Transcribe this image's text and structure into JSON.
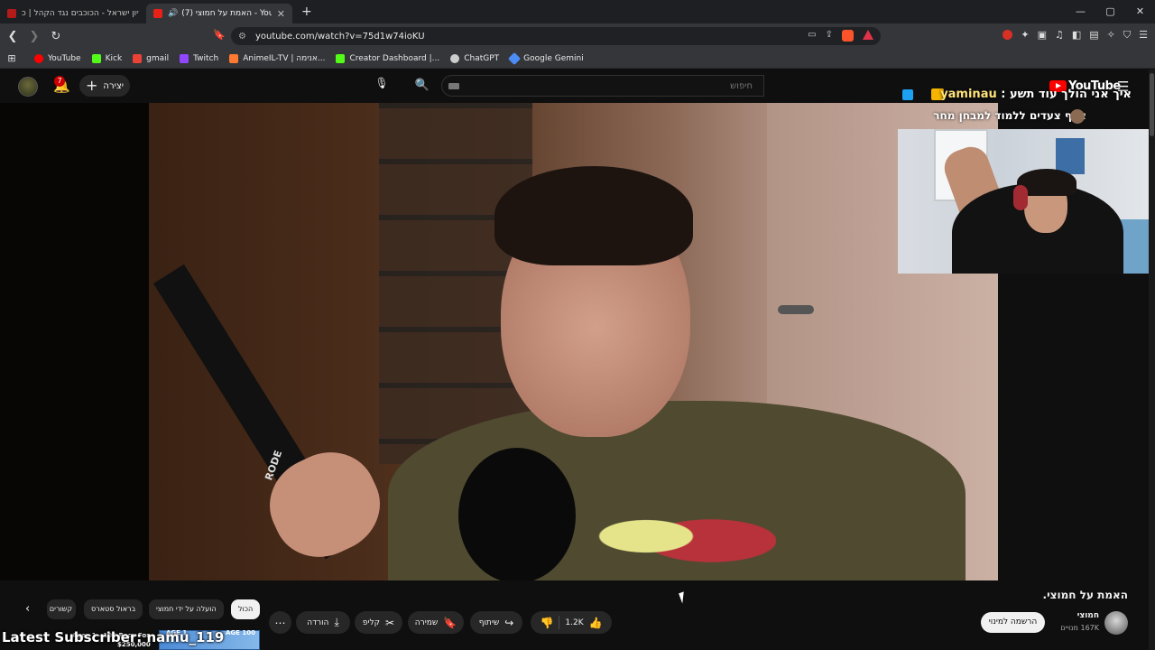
{
  "browser": {
    "tabs": [
      {
        "title": "אירוויזיון ישראל - הכוכבים נגד הקהל | כ...",
        "active": false
      },
      {
        "title": "(7) האמת על חמוצי - YouTube",
        "active": true
      }
    ],
    "new_tab_glyph": "+",
    "window_controls": [
      "—",
      "▢",
      "✕"
    ],
    "url": "youtube.com/watch?v=75d1w74ioKU",
    "bookmarks": [
      {
        "label": "YouTube",
        "icon": "youtube-icon",
        "color": "#ff0000"
      },
      {
        "label": "Kick",
        "icon": "kick-icon",
        "color": "#53fc18"
      },
      {
        "label": "gmail",
        "icon": "gmail-icon",
        "color": "#ea4335"
      },
      {
        "label": "Twitch",
        "icon": "twitch-icon",
        "color": "#9146ff"
      },
      {
        "label": "AnimeIL-TV | אנימה...",
        "icon": "anime-icon",
        "color": "#ff7a30"
      },
      {
        "label": "Creator Dashboard |...",
        "icon": "kick-icon",
        "color": "#53fc18"
      },
      {
        "label": "ChatGPT",
        "icon": "chatgpt-icon",
        "color": "#cccccc"
      },
      {
        "label": "Google Gemini",
        "icon": "gemini-icon",
        "color": "#4e8cf5"
      }
    ]
  },
  "youtube": {
    "notifications_count": "7",
    "create_label": "יצירה",
    "search_placeholder": "חיפוש",
    "logo_text": "YouTube",
    "video": {
      "title": "האמת על חמוצי.",
      "channel_name": "חמוצי",
      "channel_subs": "167K מנויים",
      "subscribe_label": "הרשמה למינוי",
      "likes": "1.2K",
      "share_label": "שיתוף",
      "save_label": "שמירה",
      "clip_label": "קליפ",
      "download_label": "הורדה"
    },
    "chips": [
      {
        "label": "הכול",
        "active": true
      },
      {
        "label": "הועלה על ידי חמוצי",
        "active": false
      },
      {
        "label": "בראול סטארס",
        "active": false
      },
      {
        "label": "קשורים",
        "active": false
      }
    ]
  },
  "stream_overlay": {
    "line1_user": "yaminau",
    "line1_text": "איך אני הולך עוד תשע :",
    "line2_text": "אלף צעדים ללמוד למבחן מחר",
    "footer_text": "Latest Subscriber: namu_119",
    "game_title": "Ages 1 - 100 Race For",
    "game_prize": "$250,000",
    "game_age1": "AGE 1",
    "game_age2": "AGE 100",
    "mic_label": "RODE"
  },
  "colors": {
    "youtube_red": "#ff0000",
    "bg": "#0f0f0f",
    "chip_bg": "#272727",
    "notif_badge": "#cc0000"
  }
}
